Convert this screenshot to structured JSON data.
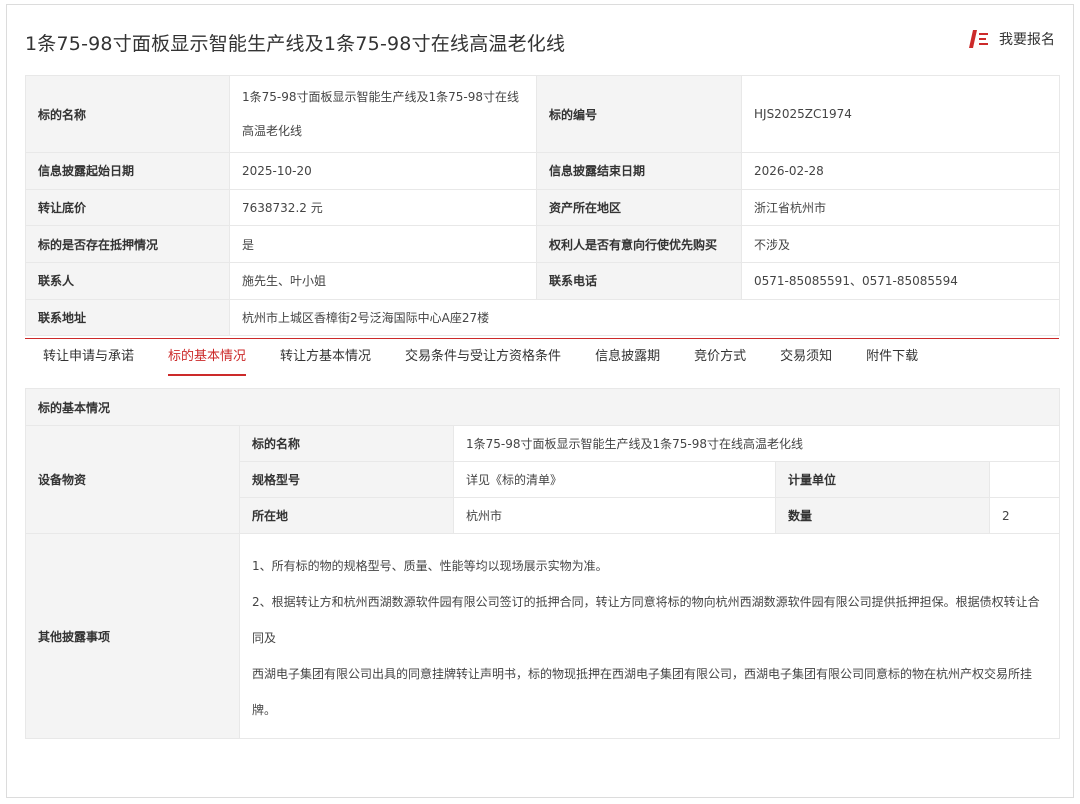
{
  "page": {
    "title": "1条75-98寸面板显示智能生产线及1条75-98寸在线高温老化线",
    "signup_label": "我要报名"
  },
  "info": {
    "rows": [
      {
        "l1": "标的名称",
        "v1": "1条75-98寸面板显示智能生产线及1条75-98寸在线高温老化线",
        "l2": "标的编号",
        "v2": "HJS2025ZC1974"
      },
      {
        "l1": "信息披露起始日期",
        "v1": "2025-10-20",
        "l2": "信息披露结束日期",
        "v2": "2026-02-28"
      },
      {
        "l1": "转让底价",
        "v1": "7638732.2 元",
        "l2": "资产所在地区",
        "v2": "浙江省杭州市"
      },
      {
        "l1": "标的是否存在抵押情况",
        "v1": "是",
        "l2": "权利人是否有意向行使优先购买",
        "v2": "不涉及"
      },
      {
        "l1": "联系人",
        "v1": "施先生、叶小姐",
        "l2": "联系电话",
        "v2": "0571-85085591、0571-85085594"
      }
    ],
    "address_label": "联系地址",
    "address_value": "杭州市上城区香樟街2号泛海国际中心A座27楼"
  },
  "tabs": [
    {
      "label": "转让申请与承诺",
      "active": false
    },
    {
      "label": "标的基本情况",
      "active": true
    },
    {
      "label": "转让方基本情况",
      "active": false
    },
    {
      "label": "交易条件与受让方资格条件",
      "active": false
    },
    {
      "label": "信息披露期",
      "active": false
    },
    {
      "label": "竞价方式",
      "active": false
    },
    {
      "label": "交易须知",
      "active": false
    },
    {
      "label": "附件下载",
      "active": false
    }
  ],
  "basic": {
    "section_title": "标的基本情况",
    "equipment_label": "设备物资",
    "name_label": "标的名称",
    "name_value": "1条75-98寸面板显示智能生产线及1条75-98寸在线高温老化线",
    "spec_label": "规格型号",
    "spec_value": "详见《标的清单》",
    "unit_label": "计量单位",
    "unit_value": "",
    "location_label": "所在地",
    "location_value": "杭州市",
    "qty_label": "数量",
    "qty_value": "2",
    "other_label": "其他披露事项",
    "note1": "1、所有标的物的规格型号、质量、性能等均以现场展示实物为准。",
    "note2a": "2、根据转让方和杭州西湖数源软件园有限公司签订的抵押合同，转让方同意将标的物向杭州西湖数源软件园有限公司提供抵押担保。根据债权转让合同及",
    "note2b": "西湖电子集团有限公司出具的同意挂牌转让声明书，标的物现抵押在西湖电子集团有限公司，西湖电子集团有限公司同意标的物在杭州产权交易所挂牌。"
  },
  "colors": {
    "accent": "#cc2a2a",
    "label_bg": "#f4f4f4",
    "border": "#e8e8e8"
  },
  "icons": {
    "signup": "signup-icon"
  }
}
